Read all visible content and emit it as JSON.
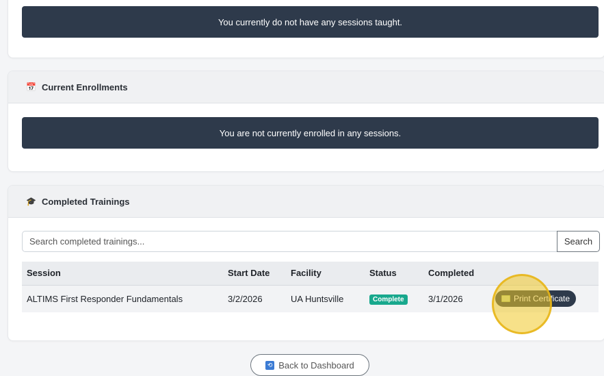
{
  "sessions_taught": {
    "empty_message": "You currently do not have any sessions taught."
  },
  "current_enrollments": {
    "icon": "calendar-icon",
    "title": "Current Enrollments",
    "empty_message": "You are not currently enrolled in any sessions."
  },
  "completed_trainings": {
    "icon": "graduation-cap-icon",
    "title": "Completed Trainings",
    "search": {
      "placeholder": "Search completed trainings...",
      "value": "",
      "button_label": "Search"
    },
    "columns": [
      "Session",
      "Start Date",
      "Facility",
      "Status",
      "Completed"
    ],
    "rows": [
      {
        "session": "ALTIMS First Responder Fundamentals",
        "start_date": "3/2/2026",
        "facility": "UA Huntsville",
        "status": "Complete",
        "completed": "3/1/2026",
        "action_label": "Print Certificate"
      }
    ]
  },
  "footer": {
    "back_label": "Back to Dashboard"
  },
  "colors": {
    "banner_bg": "#2e3a4b",
    "status_complete": "#18a88d",
    "click_highlight": "#f0c828"
  }
}
